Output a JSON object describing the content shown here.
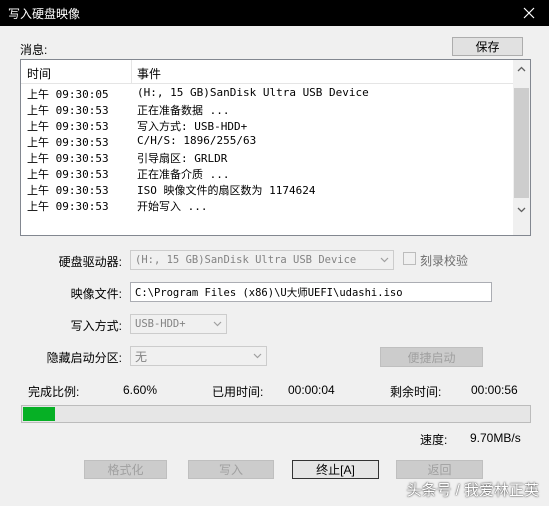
{
  "window": {
    "title": "写入硬盘映像"
  },
  "messages": {
    "label": "消息:",
    "save_label": "保存",
    "columns": {
      "time": "时间",
      "event": "事件"
    },
    "rows": [
      {
        "time": "上午 09:30:05",
        "event": "(H:, 15 GB)SanDisk Ultra USB Device"
      },
      {
        "time": "上午 09:30:53",
        "event": "正在准备数据 ..."
      },
      {
        "time": "上午 09:30:53",
        "event": "写入方式: USB-HDD+"
      },
      {
        "time": "上午 09:30:53",
        "event": "C/H/S: 1896/255/63"
      },
      {
        "time": "上午 09:30:53",
        "event": "引导扇区: GRLDR"
      },
      {
        "time": "上午 09:30:53",
        "event": "正在准备介质 ..."
      },
      {
        "time": "上午 09:30:53",
        "event": "ISO 映像文件的扇区数为 1174624"
      },
      {
        "time": "上午 09:30:53",
        "event": "开始写入 ..."
      }
    ]
  },
  "form": {
    "drive_label": "硬盘驱动器:",
    "drive_value": "(H:, 15 GB)SanDisk Ultra USB Device",
    "verify_label": "刻录校验",
    "image_label": "映像文件:",
    "image_value": "C:\\Program Files (x86)\\U大师UEFI\\udashi.iso",
    "write_mode_label": "写入方式:",
    "write_mode_value": "USB-HDD+",
    "hidden_partition_label": "隐藏启动分区:",
    "hidden_partition_value": "无",
    "quick_boot_label": "便捷启动"
  },
  "status": {
    "complete_label": "完成比例:",
    "complete_value": "6.60%",
    "progress_fraction": 0.066,
    "elapsed_label": "已用时间:",
    "elapsed_value": "00:00:04",
    "remaining_label": "剩余时间:",
    "remaining_value": "00:00:56",
    "speed_label": "速度:",
    "speed_value": "9.70MB/s"
  },
  "buttons": {
    "format": "格式化",
    "write": "写入",
    "abort": "终止[A]",
    "back": "返回"
  },
  "watermark": "头条号 / 我爱林正英",
  "colors": {
    "progress": "#06b025",
    "titlebar": "#000000"
  }
}
